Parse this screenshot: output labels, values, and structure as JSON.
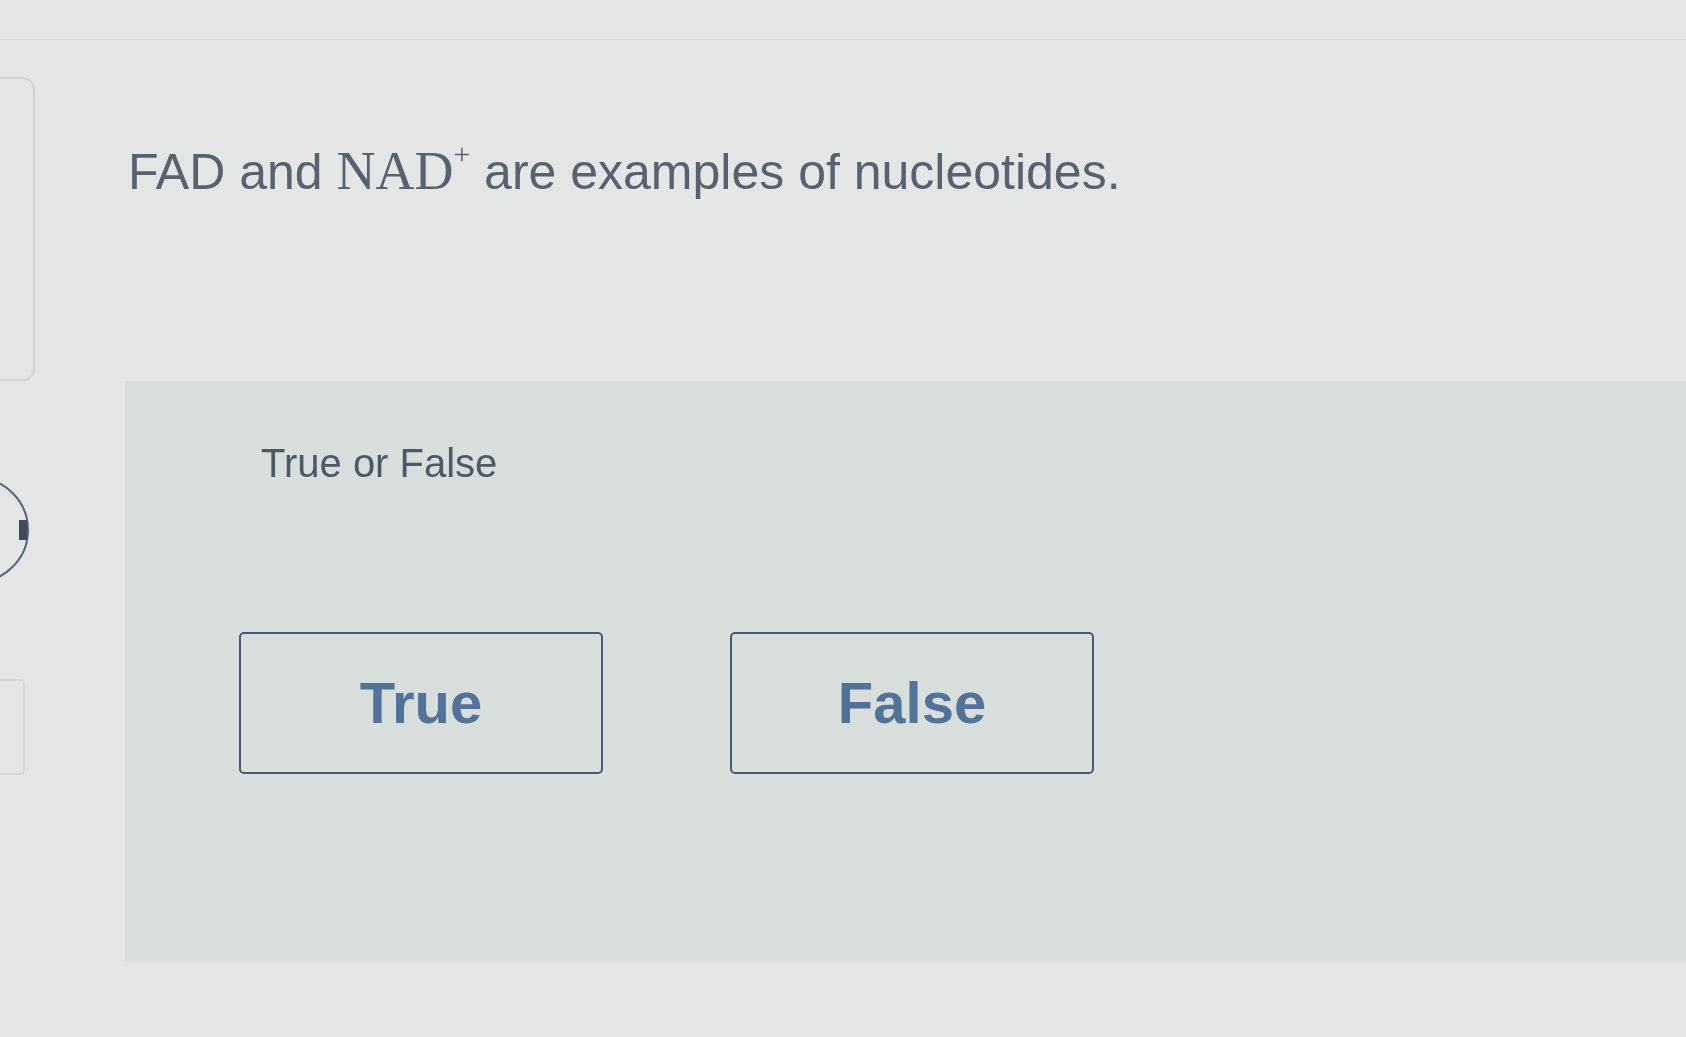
{
  "question": {
    "segments": [
      {
        "kind": "text",
        "text": "FAD and "
      },
      {
        "kind": "math",
        "text": "NAD$^{+}$"
      },
      {
        "kind": "text",
        "text": " are examples of nucleotides."
      }
    ]
  },
  "answer_panel": {
    "prompt": "True or False",
    "options": [
      {
        "label": "True",
        "selected": false
      },
      {
        "label": "False",
        "selected": false
      }
    ]
  }
}
